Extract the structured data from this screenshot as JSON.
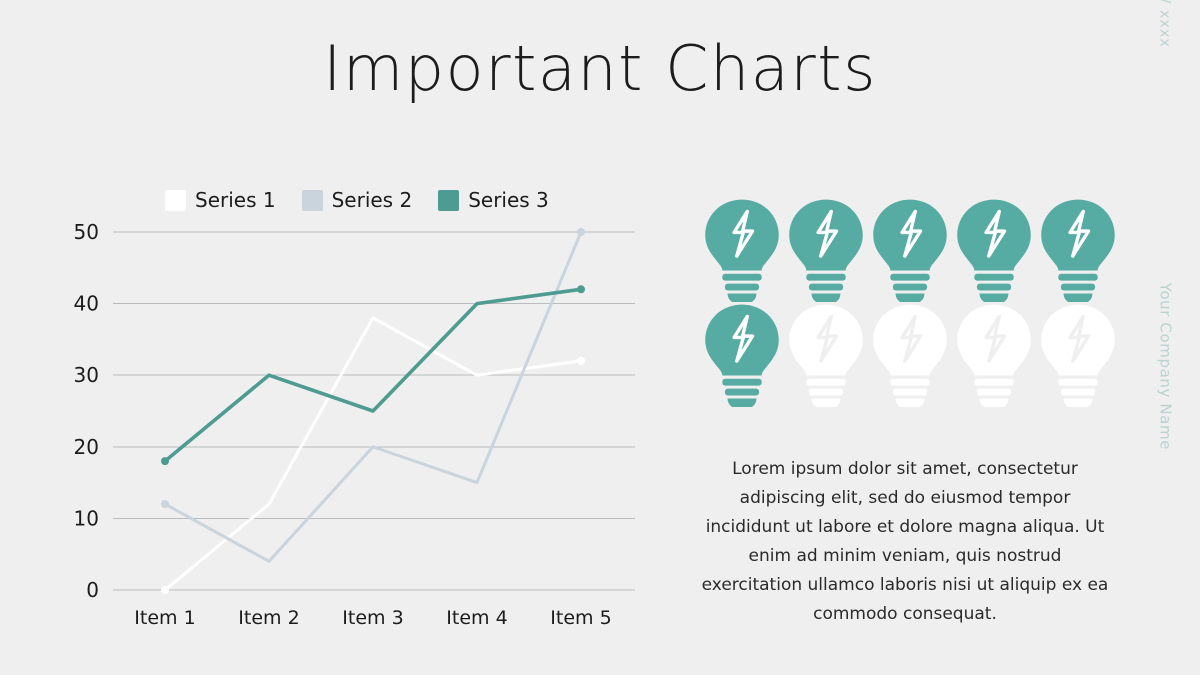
{
  "slide": {
    "title": "Important Charts",
    "background_color": "#efefef",
    "date_label": "xx / xx / xxxx",
    "company_label": "Your Company Name",
    "accent_color": "#56aba3",
    "muted_accent_color": "#b9d3d0"
  },
  "chart_data": {
    "type": "line",
    "title": "",
    "xlabel": "",
    "ylabel": "",
    "categories": [
      "Item 1",
      "Item 2",
      "Item 3",
      "Item 4",
      "Item 5"
    ],
    "ylim": [
      0,
      50
    ],
    "yticks": [
      0,
      10,
      20,
      30,
      40,
      50
    ],
    "grid": true,
    "legend_position": "top",
    "series": [
      {
        "name": "Series 1",
        "color": "#ffffff",
        "values": [
          0,
          12,
          38,
          30,
          32
        ]
      },
      {
        "name": "Series 2",
        "color": "#c9d4dc",
        "values": [
          12,
          4,
          20,
          15,
          50
        ]
      },
      {
        "name": "Series 3",
        "color": "#4e9b92",
        "values": [
          18,
          30,
          25,
          40,
          42
        ]
      }
    ]
  },
  "bulbs": {
    "total": 10,
    "filled": 6,
    "filled_color": "#56aba3",
    "empty_color": "#ffffff",
    "icon_name": "lightbulb-icon"
  },
  "body": {
    "paragraph": "Lorem ipsum dolor sit amet, consectetur adipiscing elit, sed do eiusmod tempor incididunt ut labore et dolore magna aliqua. Ut enim ad minim veniam, quis nostrud exercitation ullamco laboris nisi ut aliquip ex ea commodo consequat."
  }
}
